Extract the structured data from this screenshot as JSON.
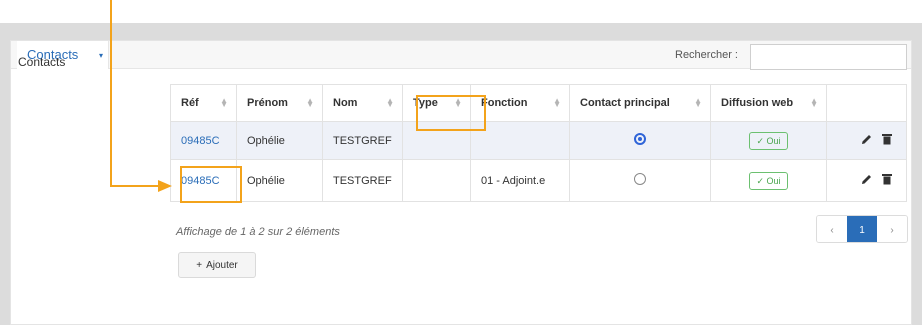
{
  "tab": {
    "label": "Contacts",
    "caret": "▾"
  },
  "section_label": "Contacts",
  "search": {
    "label": "Rechercher :",
    "value": ""
  },
  "columns": [
    "Réf",
    "Prénom",
    "Nom",
    "Type",
    "Fonction",
    "Contact principal",
    "Diffusion web",
    ""
  ],
  "rows": [
    {
      "ref": "09485C",
      "prenom": "Ophélie",
      "nom": "TESTGREF",
      "type": "",
      "fonction": "",
      "principal": true,
      "diffusion": "✓ Oui"
    },
    {
      "ref": "09485C",
      "prenom": "Ophélie",
      "nom": "TESTGREF",
      "type": "",
      "fonction": "01 - Adjoint.e",
      "principal": false,
      "diffusion": "✓ Oui"
    }
  ],
  "info": "Affichage de 1 à 2 sur 2 éléments",
  "pagination": {
    "prev": "‹",
    "page": "1",
    "next": "›"
  },
  "add_button": {
    "plus": "+",
    "label": "Ajouter"
  },
  "colors": {
    "accent": "#2a6db8",
    "highlight": "#f3a31b",
    "success": "#4aa54e",
    "row_selected": "#eef1f8"
  },
  "icons": [
    "pencil-icon",
    "trash-icon",
    "sort-icon",
    "caret-down-icon",
    "arrow-pointer-icon"
  ]
}
